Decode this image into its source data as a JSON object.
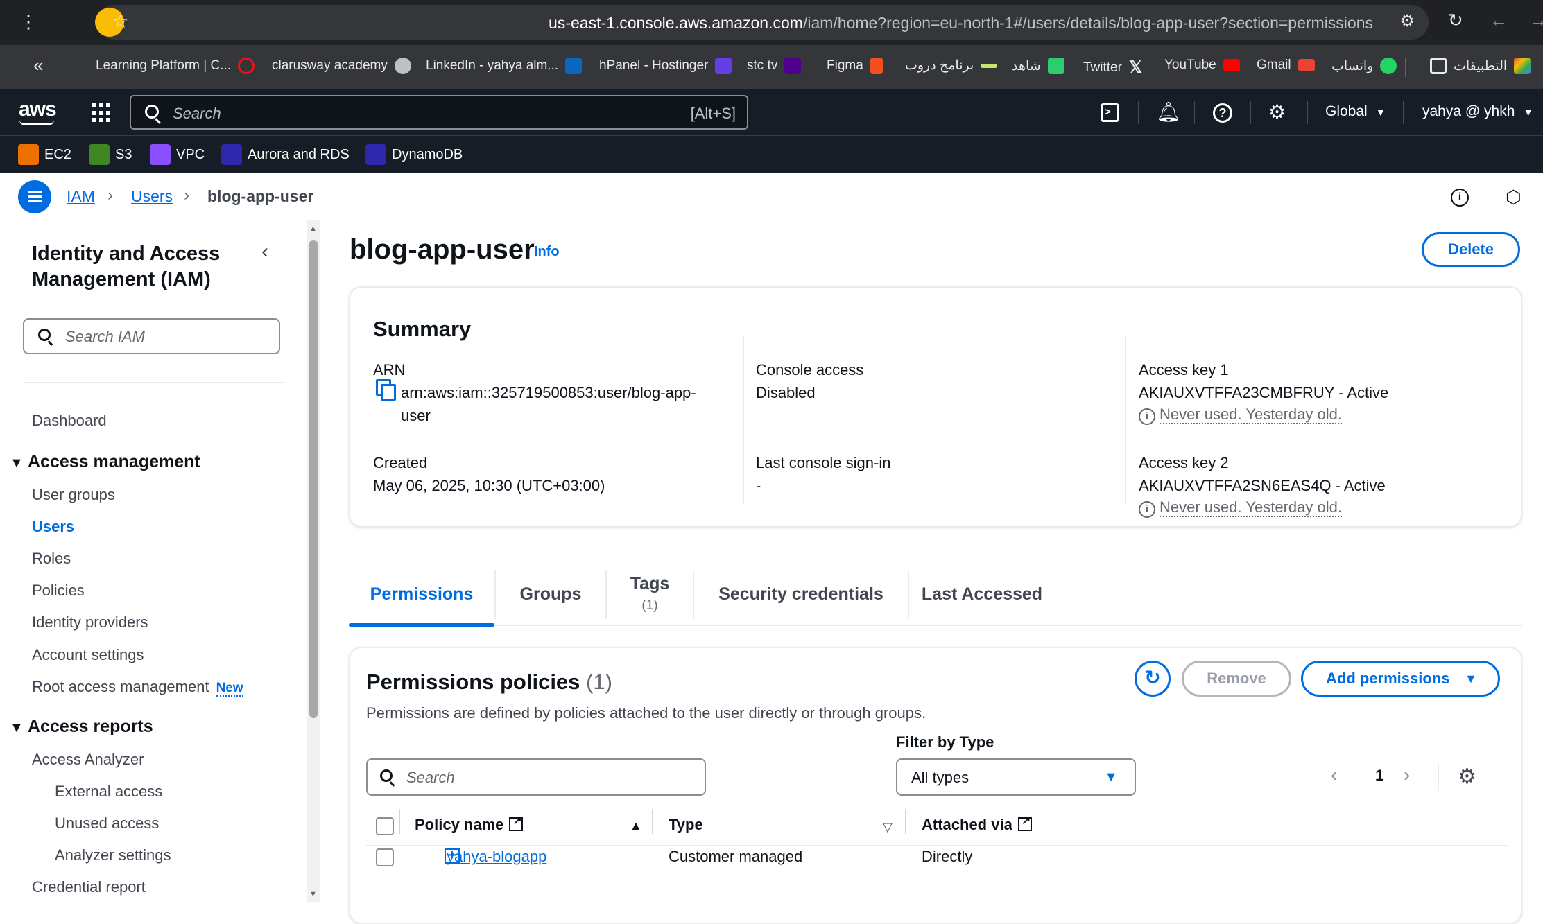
{
  "browser": {
    "url_host": "us-east-1.console.aws.amazon.com",
    "url_path": "/iam/home?region=eu-north-1#/users/details/blog-app-user?section=permissions",
    "bookmarks": [
      {
        "label": "Learning Platform | C...",
        "color": "#e8141c"
      },
      {
        "label": "clarusway academy",
        "color": "#8c8c94"
      },
      {
        "label": "LinkedIn - yahya alm...",
        "color": "#0a66c2"
      },
      {
        "label": "hPanel - Hostinger",
        "color": "#673de6"
      },
      {
        "label": "stc tv",
        "color": "#4f008c"
      },
      {
        "label": "Figma",
        "color": "#f24e1e"
      },
      {
        "label": "برنامج دروب",
        "color": "#c5e86c"
      },
      {
        "label": "شاهد",
        "color": "#2ecc71"
      },
      {
        "label": "Twitter",
        "color": "#000000"
      },
      {
        "label": "YouTube",
        "color": "#ff0000"
      },
      {
        "label": "Gmail",
        "color": "#ea4335"
      },
      {
        "label": "واتساب",
        "color": "#25d366"
      },
      {
        "label": "التطبيقات",
        "color": "#e8eaed"
      }
    ]
  },
  "aws_nav": {
    "logo": "aws",
    "search_placeholder": "Search",
    "search_shortcut": "[Alt+S]",
    "region": "Global",
    "account": "yahya @ yhkh",
    "favorites": [
      {
        "label": "EC2",
        "color": "#ed7100"
      },
      {
        "label": "S3",
        "color": "#3f8624"
      },
      {
        "label": "VPC",
        "color": "#8c4fff"
      },
      {
        "label": "Aurora and RDS",
        "color": "#2e27ad"
      },
      {
        "label": "DynamoDB",
        "color": "#2e27ad"
      }
    ]
  },
  "breadcrumb": {
    "items": [
      "IAM",
      "Users"
    ],
    "current": "blog-app-user"
  },
  "sidebar": {
    "title": "Identity and Access Management (IAM)",
    "search_placeholder": "Search IAM",
    "dashboard": "Dashboard",
    "access_management": {
      "heading": "Access management",
      "items": [
        "User groups",
        "Users",
        "Roles",
        "Policies",
        "Identity providers",
        "Account settings",
        "Root access management"
      ],
      "new_badge": "New"
    },
    "access_reports": {
      "heading": "Access reports",
      "analyzer": "Access Analyzer",
      "sub_items": [
        "External access",
        "Unused access",
        "Analyzer settings"
      ],
      "credential_report": "Credential report"
    }
  },
  "page": {
    "title": "blog-app-user",
    "info": "Info",
    "delete": "Delete"
  },
  "summary": {
    "title": "Summary",
    "arn_label": "ARN",
    "arn_line1": "arn:aws:iam::325719500853:user/blog-app-",
    "arn_line2": "user",
    "created_label": "Created",
    "created_value": "May 06, 2025, 10:30 (UTC+03:00)",
    "console_access_label": "Console access",
    "console_access_value": "Disabled",
    "last_signin_label": "Last console sign-in",
    "last_signin_value": "-",
    "key1_label": "Access key 1",
    "key1_value": "AKIAUXVTFFA23CMBFRUY - Active",
    "key1_note": "Never used. Yesterday old.",
    "key2_label": "Access key 2",
    "key2_value": "AKIAUXVTFFA2SN6EAS4Q - Active",
    "key2_note": "Never used. Yesterday old."
  },
  "tabs": {
    "permissions": "Permissions",
    "groups": "Groups",
    "tags": "Tags",
    "tags_count": "(1)",
    "security_credentials": "Security credentials",
    "last_accessed": "Last Accessed"
  },
  "permissions": {
    "title": "Permissions policies",
    "count": "(1)",
    "description": "Permissions are defined by policies attached to the user directly or through groups.",
    "remove": "Remove",
    "add": "Add permissions",
    "filter_label": "Filter by Type",
    "search_placeholder": "Search",
    "filter_value": "All types",
    "page": "1",
    "columns": [
      "Policy name",
      "Type",
      "Attached via"
    ],
    "rows": [
      {
        "name": "yahya-blogapp",
        "type": "Customer managed",
        "attached": "Directly"
      }
    ]
  }
}
